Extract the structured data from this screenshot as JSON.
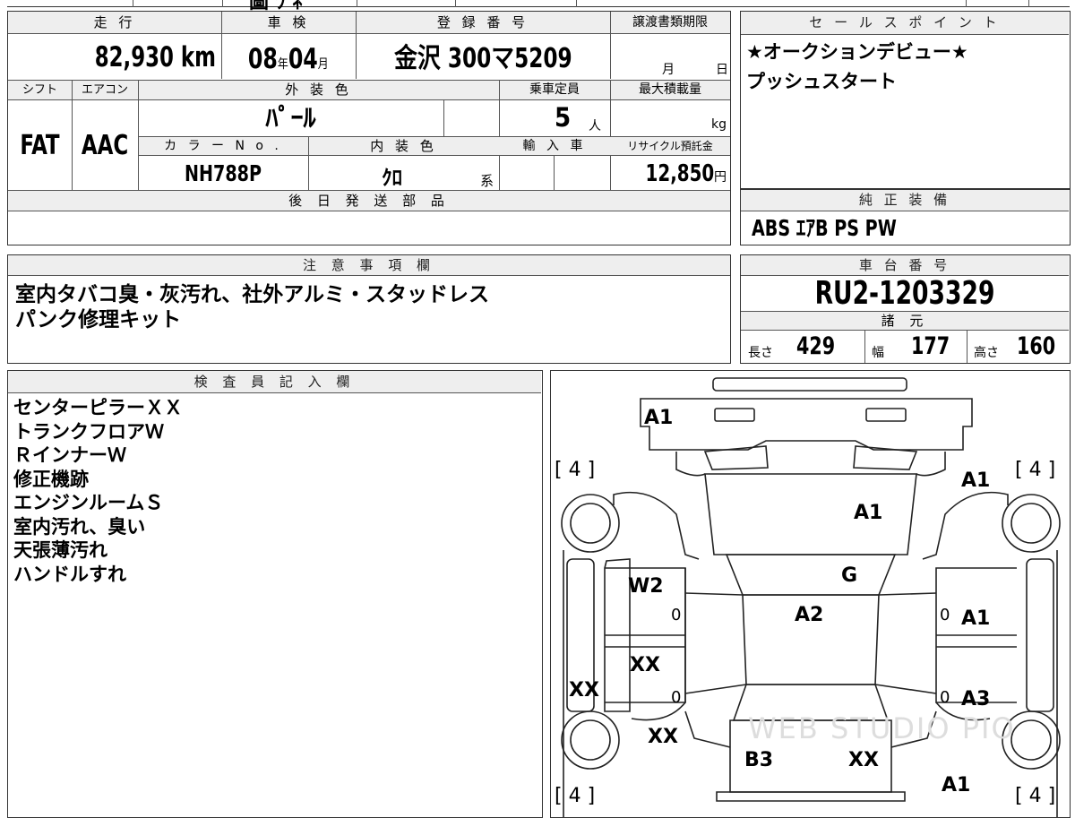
{
  "top_strip": {
    "fragment": "圖 ﾗ ﾈ"
  },
  "mileage": {
    "header": "走 行",
    "value": "82,930",
    "unit": "km"
  },
  "inspection": {
    "header": "車 検",
    "year": "08",
    "year_unit": "年",
    "month": "04",
    "month_unit": "月"
  },
  "registration": {
    "header": "登 録 番 号",
    "value": "金沢 300マ5209"
  },
  "transfer_deadline": {
    "header": "譲渡書類期限",
    "month_unit": "月",
    "day_unit": "日"
  },
  "shift": {
    "header": "シフト",
    "value": "FAT"
  },
  "aircon": {
    "header": "エアコン",
    "value": "AAC"
  },
  "exterior_color": {
    "header": "外 装 色",
    "value": "ﾊﾟｰﾙ"
  },
  "capacity": {
    "header": "乗車定員",
    "value": "5",
    "unit": "人"
  },
  "max_load": {
    "header": "最大積載量",
    "unit": "kg"
  },
  "color_no": {
    "header": "カ ラ ー N o .",
    "value": "NH788P"
  },
  "interior_color": {
    "header": "内 装 色",
    "value": "ｸﾛ",
    "suffix": "系"
  },
  "import": {
    "header": "輸 入 車"
  },
  "recycle": {
    "header": "リサイクル預託金",
    "value": "12,850",
    "unit": "円"
  },
  "later_parts": {
    "header": "後 日 発 送 部 品"
  },
  "sales_points": {
    "header": "セ ー ル ス ポ イ ン ト",
    "lines": [
      "★オークションデビュー★",
      "プッシュスタート"
    ]
  },
  "equipment": {
    "header": "純 正 装 備",
    "value": "ABS ｴｱB PS PW"
  },
  "caution": {
    "header": "注 意 事 項 欄",
    "lines": [
      "室内タバコ臭・灰汚れ、社外アルミ・スタッドレス",
      "パンク修理キット"
    ]
  },
  "chassis": {
    "header": "車 台 番 号",
    "value": "RU2-1203329"
  },
  "specs": {
    "header": "諸 元",
    "length_label": "長さ",
    "length": "429",
    "width_label": "幅",
    "width": "177",
    "height_label": "高さ",
    "height": "160"
  },
  "inspector": {
    "header": "検 査 員 記 入 欄",
    "lines": [
      "センターピラーＸＸ",
      "トランクフロアＷ",
      "ＲインナーＷ",
      "修正機跡",
      "エンジンルームＳ",
      "室内汚れ、臭い",
      "天張薄汚れ",
      "ハンドルすれ"
    ]
  },
  "diagram": {
    "watermark": "WEB STUDIO PIO",
    "tires": {
      "front_left": "[ 4 ]",
      "front_right": "[ 4 ]",
      "rear_left": "[ 4 ]",
      "rear_right": "[ 4 ]"
    },
    "marks": {
      "front_bumper": "A1",
      "right_front_fender": "A1",
      "hood": "A1",
      "windshield": "G",
      "roof": "A2",
      "left_front_door": "W2",
      "left_front_door_zero": "0",
      "right_front_door": "A1",
      "right_front_door_zero": "0",
      "left_rear_door": "XX",
      "left_rear_door_zero": "0",
      "left_side_sill": "XX",
      "right_rear_door": "A3",
      "right_rear_door_zero": "0",
      "left_rear_fender": "XX",
      "rear_left_panel": "B3",
      "rear_right_panel": "XX",
      "right_rear_fender": "A1"
    }
  }
}
